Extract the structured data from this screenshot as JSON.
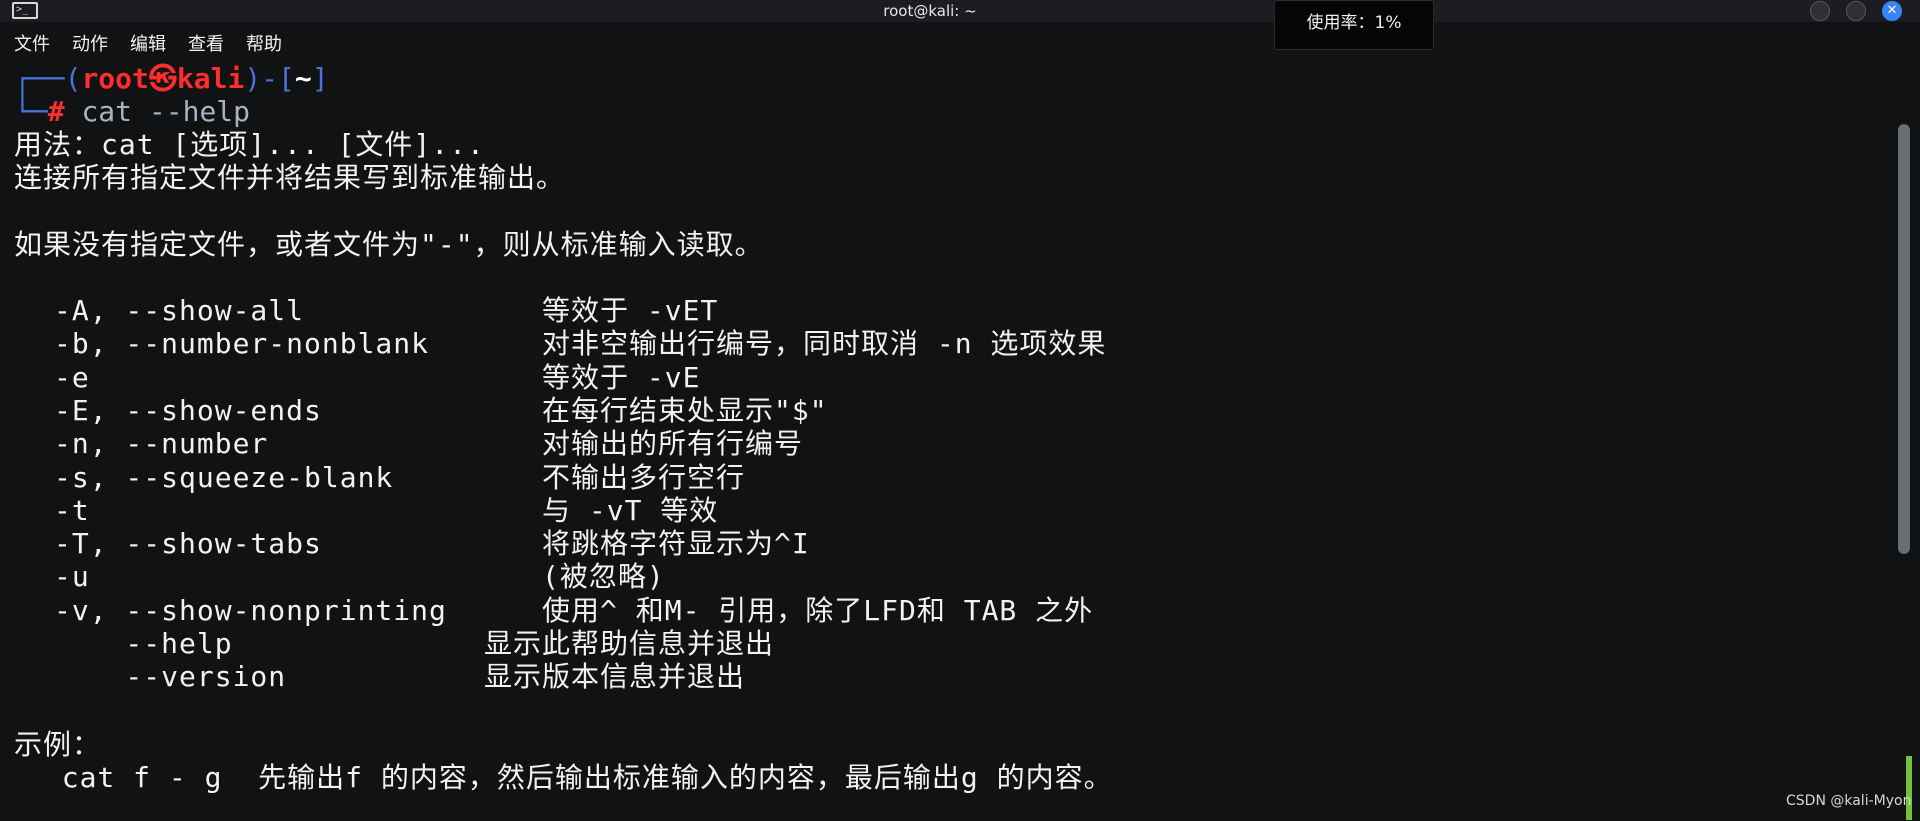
{
  "window": {
    "title": "root@kali: ~",
    "terminal_icon_glyph": ">_",
    "close_glyph": "✕"
  },
  "tooltip": {
    "text": "使用率：1%"
  },
  "menu": [
    "文件",
    "动作",
    "编辑",
    "查看",
    "帮助"
  ],
  "prompt": {
    "open": "┌──(",
    "user": "root",
    "at": "㉿",
    "host": "kali",
    "close": ")-[",
    "dir": "~",
    "end": "]",
    "corner": "└─",
    "hash": "#",
    "command": "cat --help"
  },
  "output": {
    "usage": "用法：cat [选项]... [文件]...",
    "desc": "连接所有指定文件并将结果写到标准输出。",
    "stdin_note": "如果没有指定文件，或者文件为\"-\"，则从标准输入读取。",
    "options": [
      {
        "flag": "-A, --show-all",
        "desc": "等效于 -vET"
      },
      {
        "flag": "-b, --number-nonblank",
        "desc": "对非空输出行编号，同时取消 -n 选项效果"
      },
      {
        "flag": "-e",
        "desc": "等效于 -vE"
      },
      {
        "flag": "-E, --show-ends",
        "desc": "在每行结束处显示\"$\""
      },
      {
        "flag": "-n, --number",
        "desc": "对输出的所有行编号"
      },
      {
        "flag": "-s, --squeeze-blank",
        "desc": "不输出多行空行"
      },
      {
        "flag": "-t",
        "desc": "与 -vT 等效"
      },
      {
        "flag": "-T, --show-tabs",
        "desc": "将跳格字符显示为^I"
      },
      {
        "flag": "-u",
        "desc": "(被忽略)"
      },
      {
        "flag": "-v, --show-nonprinting",
        "desc": "使用^ 和M- 引用，除了LFD和 TAB 之外"
      },
      {
        "flag": "    --help",
        "desc": "显示此帮助信息并退出"
      },
      {
        "flag": "    --version",
        "desc": "显示版本信息并退出"
      }
    ],
    "examples_header": "示例：",
    "example_line": "  cat f - g  先输出f 的内容，然后输出标准输入的内容，最后输出g 的内容。"
  },
  "watermark": "CSDN @kali-Myon"
}
